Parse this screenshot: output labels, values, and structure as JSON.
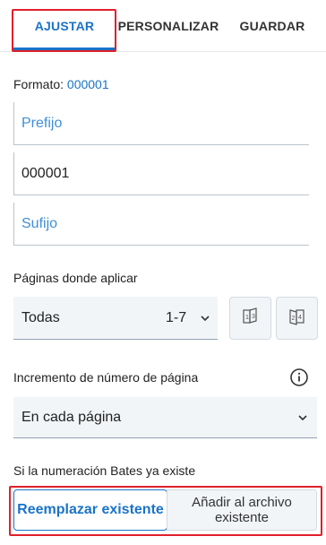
{
  "tabs": {
    "ajustar": "AJUSTAR",
    "personalizar": "PERSONALIZAR",
    "guardar": "GUARDAR",
    "active": "AJUSTAR"
  },
  "format": {
    "label": "Formato:",
    "value": "000001"
  },
  "fields": {
    "prefijo_placeholder": "Prefijo",
    "numero_value": "000001",
    "sufijo_placeholder": "Sufijo"
  },
  "pages": {
    "label": "Páginas donde aplicar",
    "selected": "Todas",
    "range": "1-7",
    "odd_icon": "odd-pages-icon",
    "even_icon": "even-pages-icon"
  },
  "increment": {
    "label": "Incremento de número de página",
    "selected": "En cada página",
    "info_icon": "info-icon"
  },
  "existing": {
    "label": "Si la numeración Bates ya existe",
    "replace": "Reemplazar existente",
    "append": "Añadir al archivo existente"
  },
  "colors": {
    "accent": "#1a73c7",
    "highlight": "#e0202b",
    "field_bg": "#f2f5f8"
  }
}
